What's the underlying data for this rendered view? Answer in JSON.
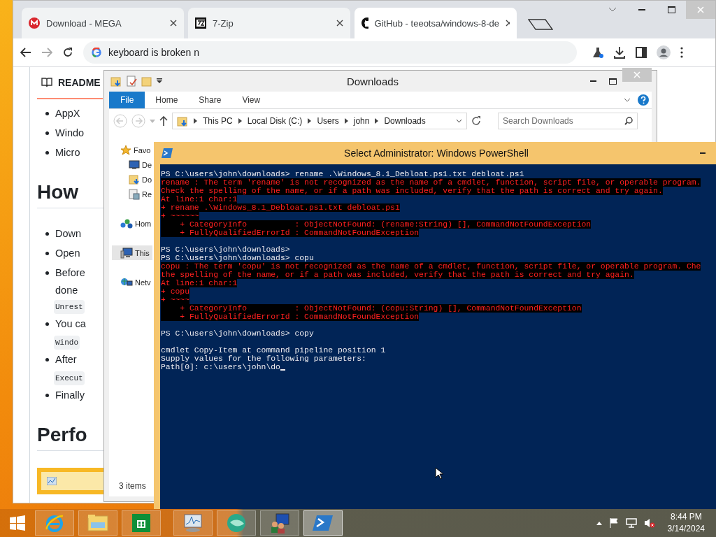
{
  "browser": {
    "tabs": [
      {
        "title": "Download - MEGA",
        "kind": "mega",
        "selected": false
      },
      {
        "title": "7-Zip",
        "kind": "sevenzip",
        "selected": false
      },
      {
        "title": "GitHub - teeotsa/windows-8-de",
        "kind": "github",
        "selected": true
      }
    ],
    "address": "keyboard is broken n",
    "page": {
      "tab_label": "README",
      "content": [
        {
          "kind": "bullet",
          "text": "AppX"
        },
        {
          "kind": "bullet",
          "text": "Windo"
        },
        {
          "kind": "bullet",
          "text": "Micro"
        },
        {
          "kind": "heading",
          "text": "How"
        },
        {
          "kind": "bullet",
          "text": "Down"
        },
        {
          "kind": "bullet",
          "text": "Open"
        },
        {
          "kind": "bullet",
          "text": "Before"
        },
        {
          "kind": "line",
          "text": "done"
        },
        {
          "kind": "code",
          "text": "Unrest"
        },
        {
          "kind": "bullet",
          "text": "You ca"
        },
        {
          "kind": "code",
          "text": "Windo"
        },
        {
          "kind": "bullet",
          "text": "After"
        },
        {
          "kind": "code",
          "text": "Execut"
        },
        {
          "kind": "bullet",
          "text": "Finally"
        },
        {
          "kind": "heading",
          "text": "Perfo"
        }
      ]
    }
  },
  "explorer": {
    "title": "Downloads",
    "ribbon_tabs": [
      {
        "label": "File",
        "selected": true
      },
      {
        "label": "Home",
        "selected": false
      },
      {
        "label": "Share",
        "selected": false
      },
      {
        "label": "View",
        "selected": false
      }
    ],
    "path": [
      "This PC",
      "Local Disk (C:)",
      "Users",
      "john",
      "Downloads"
    ],
    "search": {
      "placeholder": "Search Downloads"
    },
    "nav": [
      {
        "label": "Favo",
        "kind": "favorites",
        "selected": false,
        "children": [
          {
            "label": "De",
            "kind": "desktop",
            "selected": false
          },
          {
            "label": "Do",
            "kind": "downloads",
            "selected": false
          },
          {
            "label": "Re",
            "kind": "recent",
            "selected": false
          }
        ]
      },
      {
        "label": "Hom",
        "kind": "homegroup",
        "selected": false
      },
      {
        "label": "This",
        "kind": "computer",
        "selected": true
      },
      {
        "label": "Netv",
        "kind": "network",
        "selected": false
      }
    ],
    "status": "3 items"
  },
  "powershell": {
    "title": "Select Administrator: Windows PowerShell",
    "lines": [
      {
        "kind": "normal",
        "text": "PS C:\\users\\john\\downloads> rename .\\Windows_8.1_Debloat.ps1.txt debloat.ps1"
      },
      {
        "kind": "error",
        "text": "rename : The term 'rename' is not recognized as the name of a cmdlet, function, script file, or operable program."
      },
      {
        "kind": "error",
        "text": "Check the spelling of the name, or if a path was included, verify that the path is correct and try again."
      },
      {
        "kind": "error",
        "text": "At line:1 char:1"
      },
      {
        "kind": "error",
        "text": "+ rename .\\Windows_8.1_Debloat.ps1.txt debloat.ps1"
      },
      {
        "kind": "error",
        "text": "+ ~~~~~~"
      },
      {
        "kind": "error",
        "text": "    + CategoryInfo          : ObjectNotFound: (rename:String) [], CommandNotFoundException"
      },
      {
        "kind": "error",
        "text": "    + FullyQualifiedErrorId : CommandNotFoundException"
      },
      {
        "kind": "blank"
      },
      {
        "kind": "normal",
        "text": "PS C:\\users\\john\\downloads>"
      },
      {
        "kind": "normal",
        "text": "PS C:\\users\\john\\downloads> copu"
      },
      {
        "kind": "error",
        "text": "copu : The term 'copu' is not recognized as the name of a cmdlet, function, script file, or operable program. Che"
      },
      {
        "kind": "error",
        "text": "the spelling of the name, or if a path was included, verify that the path is correct and try again."
      },
      {
        "kind": "error",
        "text": "At line:1 char:1"
      },
      {
        "kind": "error",
        "text": "+ copu"
      },
      {
        "kind": "error",
        "text": "+ ~~~~"
      },
      {
        "kind": "error",
        "text": "    + CategoryInfo          : ObjectNotFound: (copu:String) [], CommandNotFoundException"
      },
      {
        "kind": "error",
        "text": "    + FullyQualifiedErrorId : CommandNotFoundException"
      },
      {
        "kind": "blank"
      },
      {
        "kind": "normal",
        "text": "PS C:\\users\\john\\downloads> copy"
      },
      {
        "kind": "blank"
      },
      {
        "kind": "normal",
        "text": "cmdlet Copy-Item at command pipeline position 1"
      },
      {
        "kind": "normal",
        "text": "Supply values for the following parameters:"
      },
      {
        "kind": "prompt",
        "text": "Path[0]: c:\\users\\john\\do"
      }
    ]
  },
  "taskbar": {
    "pinned": [
      {
        "kind": "ie",
        "selected": false
      },
      {
        "kind": "explorer",
        "selected": false
      },
      {
        "kind": "store",
        "selected": false
      },
      {
        "kind": "monitor",
        "selected": false
      },
      {
        "kind": "orb",
        "selected": false
      },
      {
        "kind": "users",
        "selected": false
      },
      {
        "kind": "powershell",
        "selected": true
      }
    ],
    "time": "8:44 PM",
    "date": "3/14/2024"
  }
}
